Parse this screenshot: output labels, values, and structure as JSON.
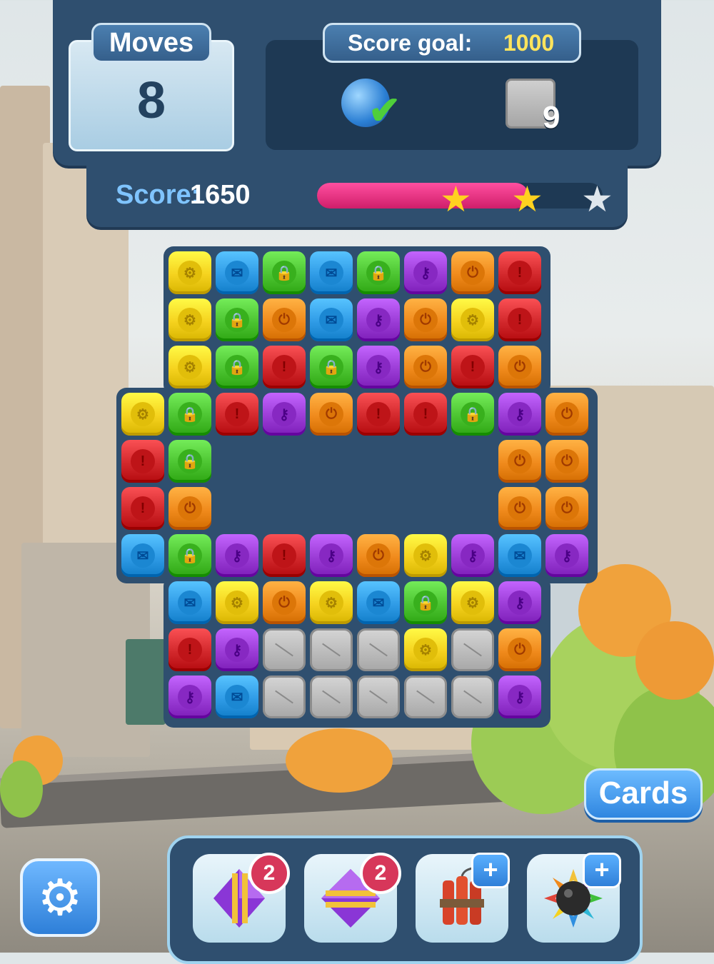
{
  "hud": {
    "moves_label": "Moves",
    "moves_value": "8",
    "score_goal_label": "Score goal:",
    "score_goal_value": "1000",
    "goal_items": [
      {
        "icon": "globe-icon",
        "completed": true
      },
      {
        "icon": "stone-block-icon",
        "remaining": "9"
      }
    ],
    "score_label": "Score:",
    "score_value": "1650",
    "progress": 0.74,
    "stars_earned": 2,
    "stars_total": 3
  },
  "board": {
    "legend": {
      "Y": {
        "color": "#f5d21e",
        "icon": "gear-icon",
        "glyph": "⚙"
      },
      "B": {
        "color": "#2f9be6",
        "icon": "mail-icon",
        "glyph": "✉"
      },
      "G": {
        "color": "#4cc431",
        "icon": "shield-lock-icon",
        "glyph": "🔒"
      },
      "P": {
        "color": "#9b3cd6",
        "icon": "key-icon",
        "glyph": "⚷"
      },
      "O": {
        "color": "#f08a1c",
        "icon": "power-icon",
        "glyph": "⏻"
      },
      "R": {
        "color": "#d2282c",
        "icon": "warning-icon",
        "glyph": "!"
      },
      "S": {
        "color": "#b8b8b8",
        "icon": "stone-block-icon",
        "glyph": ""
      }
    },
    "rows": [
      [
        ".",
        "Y",
        "B",
        "G",
        "B",
        "G",
        "P",
        "O",
        "R",
        "."
      ],
      [
        ".",
        "Y",
        "G",
        "O",
        "B",
        "P",
        "O",
        "Y",
        "R",
        "."
      ],
      [
        ".",
        "Y",
        "G",
        "R",
        "G",
        "P",
        "O",
        "R",
        "O",
        "."
      ],
      [
        "Y",
        "G",
        "R",
        "P",
        "O",
        "R",
        "R",
        "G",
        "P",
        "O"
      ],
      [
        "R",
        "G",
        ".",
        ".",
        ".",
        ".",
        ".",
        ".",
        "O",
        "O"
      ],
      [
        "R",
        "O",
        ".",
        ".",
        ".",
        ".",
        ".",
        ".",
        "O",
        "O"
      ],
      [
        "B",
        "G",
        "P",
        "R",
        "P",
        "O",
        "Y",
        "P",
        "B",
        "P"
      ],
      [
        ".",
        "B",
        "Y",
        "O",
        "Y",
        "B",
        "G",
        "Y",
        "P",
        "."
      ],
      [
        ".",
        "R",
        "P",
        "S",
        "S",
        "S",
        "Y",
        "S",
        "O",
        "."
      ],
      [
        ".",
        "P",
        "B",
        "S",
        "S",
        "S",
        "S",
        "S",
        "P",
        "."
      ]
    ]
  },
  "buttons": {
    "cards_label": "Cards",
    "settings_icon": "gear-icon"
  },
  "boosters": [
    {
      "name": "vertical-rocket",
      "icon": "purple-gem-vertical-icon",
      "badge": "2",
      "badge_type": "count"
    },
    {
      "name": "horizontal-rocket",
      "icon": "purple-gem-horizontal-icon",
      "badge": "2",
      "badge_type": "count"
    },
    {
      "name": "dynamite",
      "icon": "dynamite-icon",
      "badge": "+",
      "badge_type": "add"
    },
    {
      "name": "bomb",
      "icon": "spiked-bomb-icon",
      "badge": "+",
      "badge_type": "add"
    }
  ]
}
